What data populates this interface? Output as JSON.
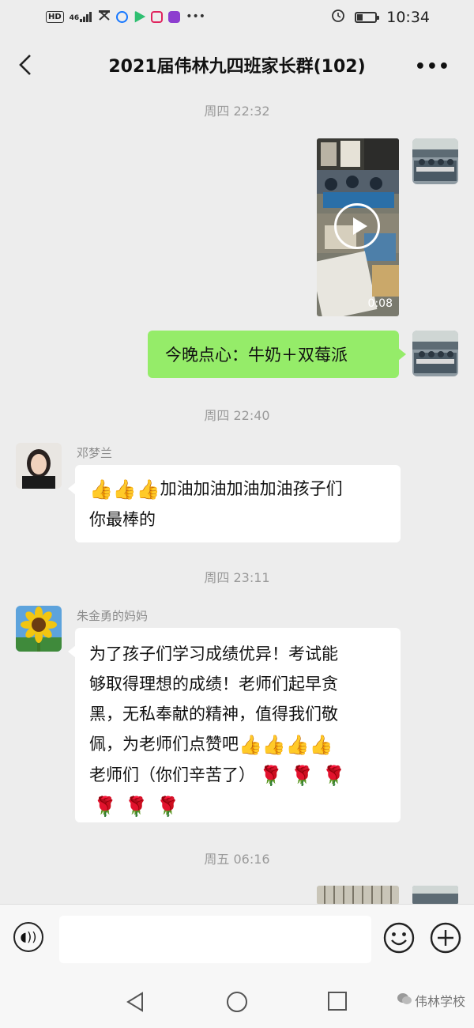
{
  "status_bar": {
    "left_chip": "HD",
    "signal": "46",
    "time": "10:34",
    "battery_level": 0.3
  },
  "header": {
    "title": "2021届伟林九四班家长群(102)",
    "more_icon": "more-dots-icon",
    "back_icon": "chevron-left-icon"
  },
  "messages": {
    "ts1": "周四 22:32",
    "video_duration": "0:08",
    "self_text": "今晚点心：牛奶＋双莓派",
    "ts2": "周四 22:40",
    "m1_sender": "邓梦兰",
    "m1_line1": "加油加油加油加油孩子们",
    "m1_line2": "你最棒的",
    "ts3": "周四 23:11",
    "m2_sender": "朱金勇的妈妈",
    "m2_line1": "为了孩子们学习成绩优异！考试能",
    "m2_line2": "够取得理想的成绩！老师们起早贪",
    "m2_line3": "黑，无私奉献的精神，值得我们敬",
    "m2_line4": "佩，为老师们点赞吧",
    "m2_line5": "老师们（你们辛苦了）",
    "ts4": "周五 06:16"
  },
  "emoji": {
    "thumb": "👍",
    "rose": "🌹"
  },
  "watermark": "伟林学校",
  "colors": {
    "bg": "#ededed",
    "self_bubble": "#95ec69",
    "other_bubble": "#ffffff"
  }
}
